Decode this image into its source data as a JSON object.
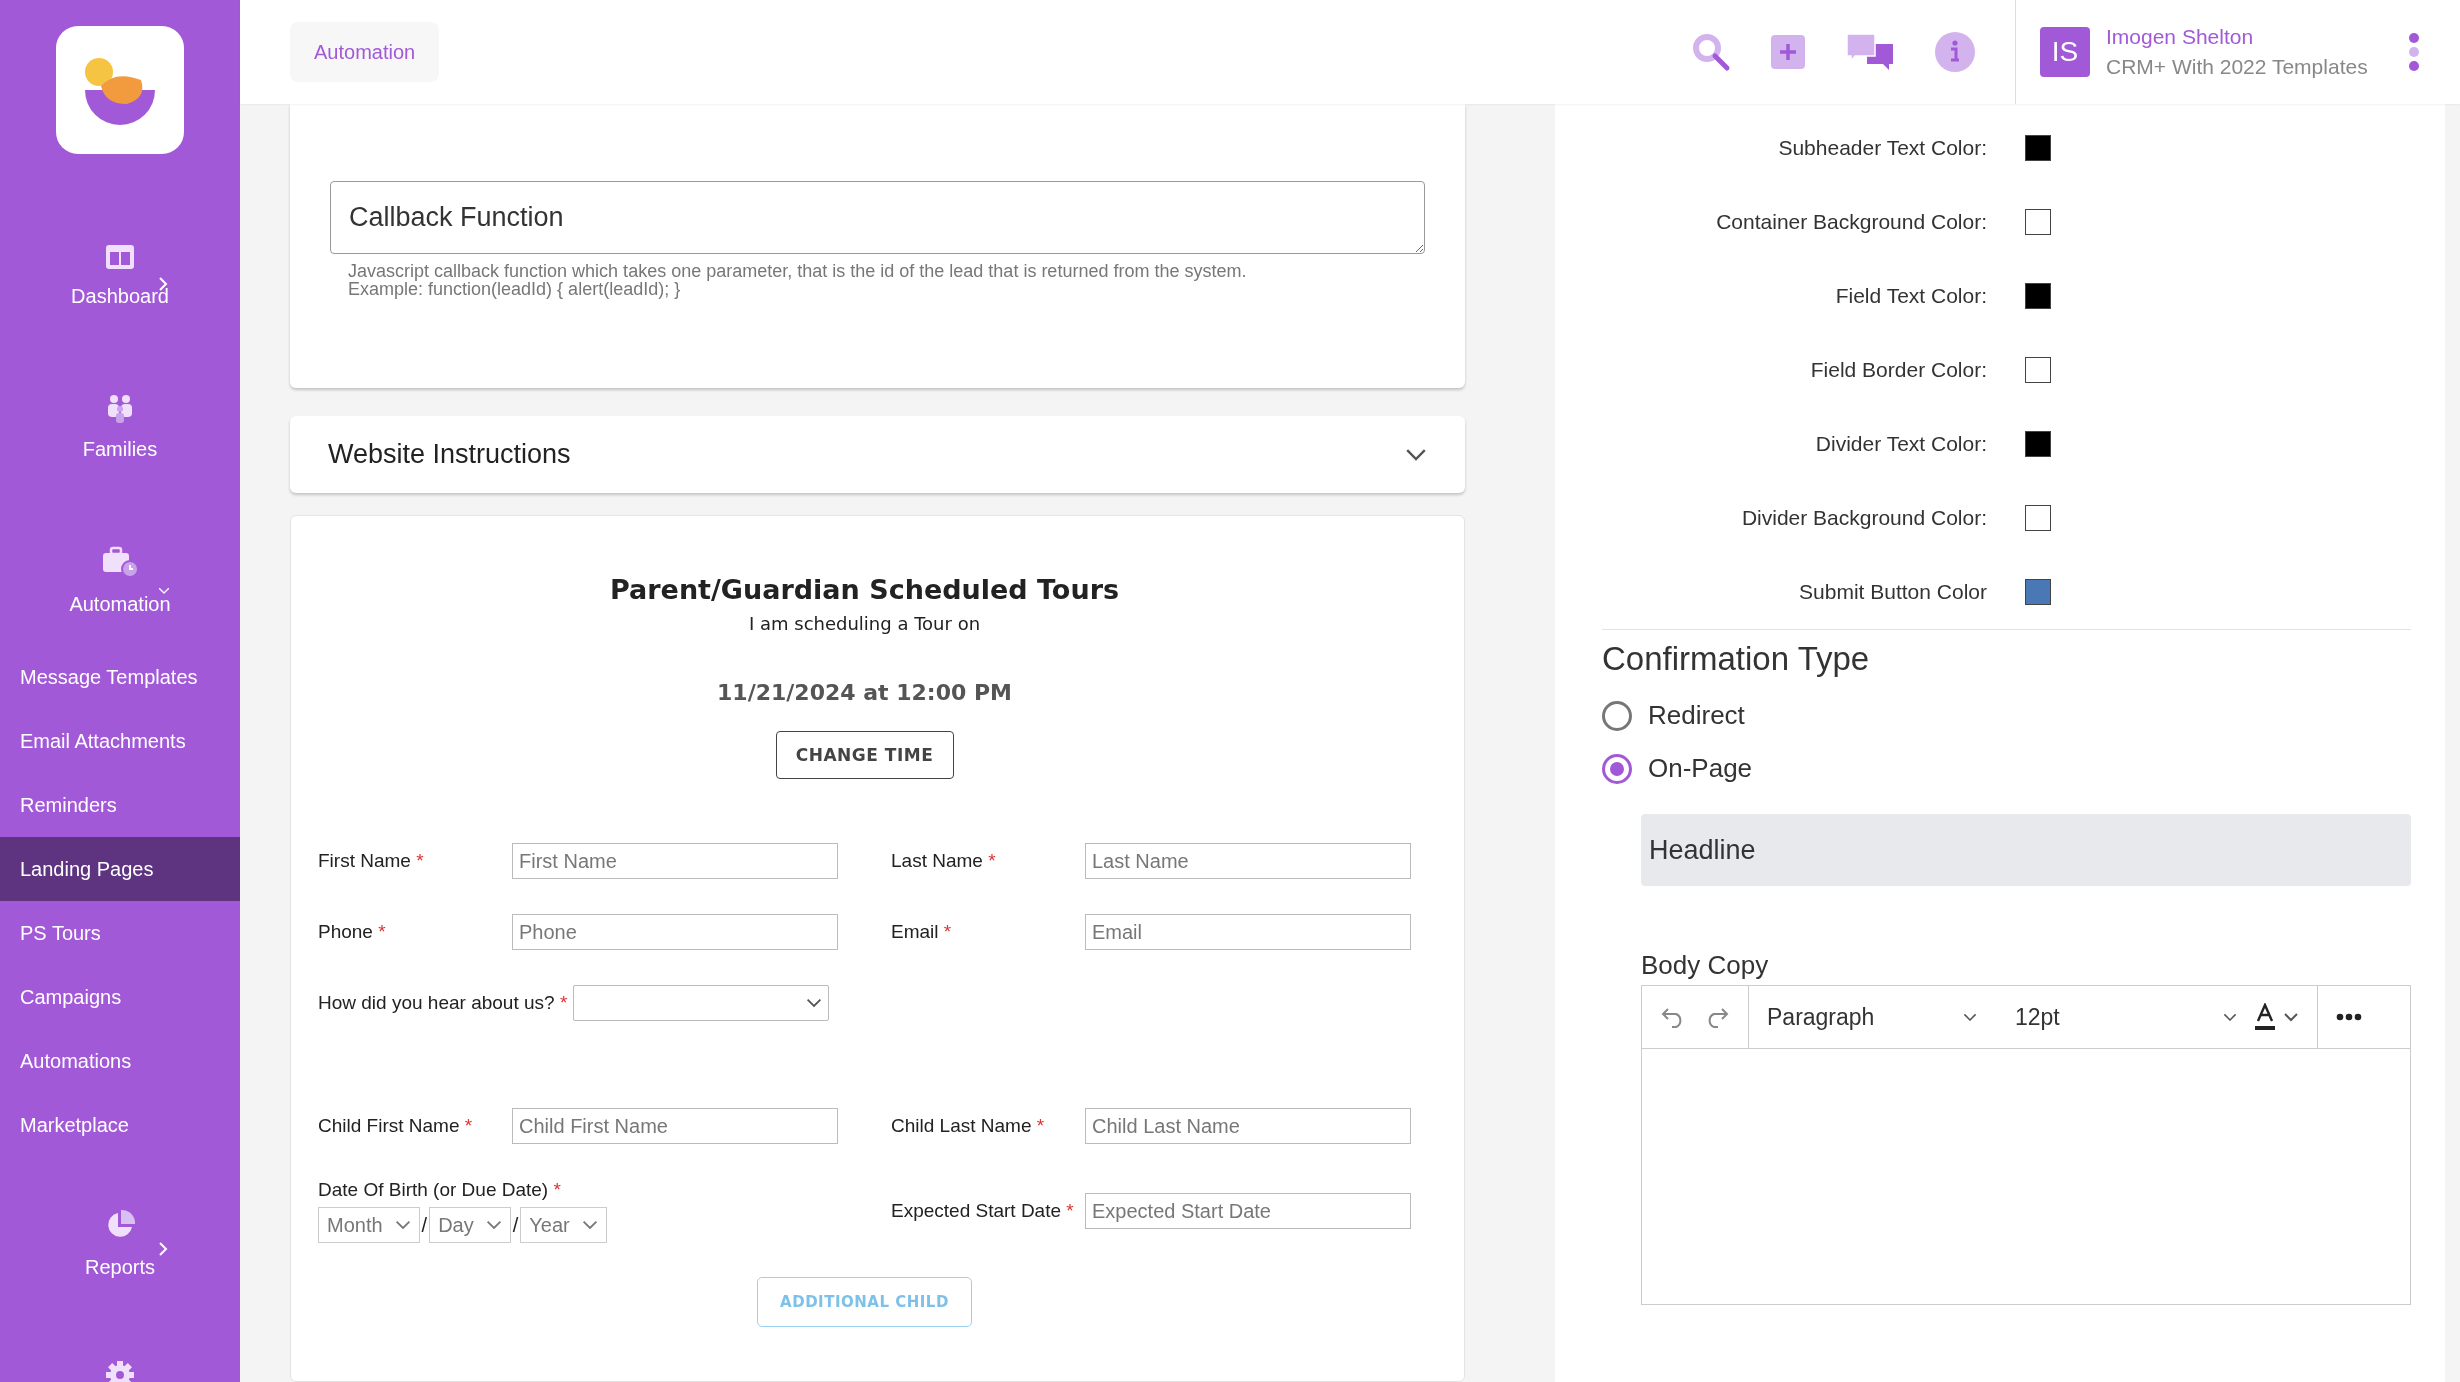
{
  "sidebar": {
    "items": [
      {
        "label": "Dashboard",
        "kind": "group",
        "expanded": false
      },
      {
        "label": "Families",
        "kind": "link"
      },
      {
        "label": "Automation",
        "kind": "group",
        "expanded": true,
        "children": [
          {
            "label": "Message Templates",
            "selected": false
          },
          {
            "label": "Email Attachments",
            "selected": false
          },
          {
            "label": "Reminders",
            "selected": false
          },
          {
            "label": "Landing Pages",
            "selected": true
          },
          {
            "label": "PS Tours",
            "selected": false
          },
          {
            "label": "Campaigns",
            "selected": false
          },
          {
            "label": "Automations",
            "selected": false
          },
          {
            "label": "Marketplace",
            "selected": false
          }
        ]
      },
      {
        "label": "Reports",
        "kind": "group",
        "expanded": false
      }
    ]
  },
  "topbar": {
    "breadcrumb": "Automation",
    "user": {
      "initials": "IS",
      "name": "Imogen Shelton",
      "subtitle": "CRM+ With 2022 Templates"
    }
  },
  "callback": {
    "placeholder": "Callback Function",
    "help": [
      "Javascript callback function which takes one parameter, that is the id of the lead that is returned from the system.",
      "Example: function(leadId) { alert(leadId); }"
    ]
  },
  "website_instructions": {
    "title": "Website Instructions",
    "expanded": false
  },
  "form_preview": {
    "title": "Parent/Guardian Scheduled Tours",
    "subtitle": "I am scheduling a Tour on",
    "datetime": "11/21/2024 at 12:00 PM",
    "change_button": "CHANGE TIME",
    "rows": [
      [
        {
          "kind": "text",
          "label": "First Name",
          "required_mark": "*",
          "placeholder": "First Name"
        },
        {
          "kind": "text",
          "label": "Last Name",
          "required_mark": "*",
          "placeholder": "Last Name"
        }
      ],
      [
        {
          "kind": "text",
          "label": "Phone",
          "required_mark": "*",
          "placeholder": "Phone"
        },
        {
          "kind": "text",
          "label": "Email",
          "required_mark": "*",
          "placeholder": "Email"
        }
      ],
      [
        {
          "kind": "select",
          "label": "How did you hear about us?",
          "required_mark": "*"
        }
      ],
      [
        {
          "kind": "text",
          "label": "Child First Name",
          "required_mark": "*",
          "placeholder": "Child First Name"
        },
        {
          "kind": "text",
          "label": "Child Last Name",
          "required_mark": "*",
          "placeholder": "Child Last Name"
        }
      ],
      [
        {
          "kind": "date-parts",
          "label": "Date Of Birth (or Due Date)",
          "required_mark": "*",
          "parts": [
            "Month",
            "Day",
            "Year"
          ],
          "separator": "/"
        },
        {
          "kind": "text",
          "label": "Expected Start Date",
          "required_mark": "*",
          "placeholder": "Expected Start Date"
        }
      ]
    ],
    "add_button": "ADDITIONAL CHILD"
  },
  "color_settings": [
    {
      "label": "Subheader Text Color:",
      "color": "#000000"
    },
    {
      "label": "Container Background Color:",
      "color": "#ffffff"
    },
    {
      "label": "Field Text Color:",
      "color": "#000000"
    },
    {
      "label": "Field Border Color:",
      "color": "#ffffff"
    },
    {
      "label": "Divider Text Color:",
      "color": "#000000"
    },
    {
      "label": "Divider Background Color:",
      "color": "#ffffff"
    },
    {
      "label": "Submit Button Color",
      "color": "#4a78b5"
    }
  ],
  "confirmation": {
    "title": "Confirmation Type",
    "options": [
      {
        "label": "Redirect",
        "selected": false
      },
      {
        "label": "On-Page",
        "selected": true
      }
    ],
    "headline": {
      "placeholder": "Headline"
    },
    "body_label": "Body Copy",
    "editor": {
      "block_format": "Paragraph",
      "font_size": "12pt"
    }
  }
}
